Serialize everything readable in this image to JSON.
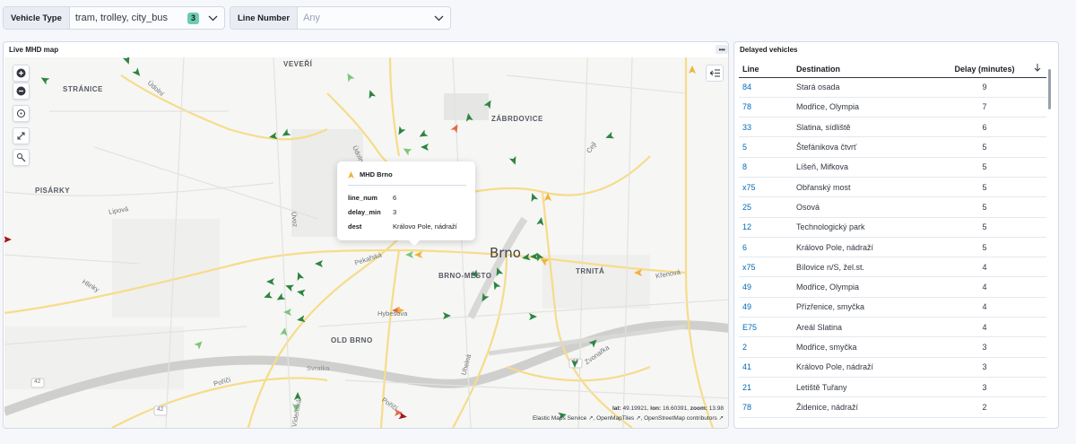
{
  "filters": {
    "vehicle_type": {
      "label": "Vehicle Type",
      "value": "tram, trolley, city_bus",
      "count": "3"
    },
    "line_number": {
      "label": "Line Number",
      "placeholder": "Any"
    }
  },
  "map_panel": {
    "title": "Live MHD map",
    "districts": [
      "VEVEŘÍ",
      "STRÁNICE",
      "ZÁBRDOVICE",
      "PISÁRKY",
      "BRNO-MĚSTO",
      "TRNITÁ",
      "OLD BRNO"
    ],
    "city": "Brno",
    "streets": [
      "Údolní",
      "Údolní",
      "Cejl",
      "Lipová",
      "Úvoz",
      "Pekařská",
      "Hlinky",
      "Hybešova",
      "Křenová",
      "Uhelná",
      "Svratka",
      "Poříčí",
      "Zvonařka",
      "Poříčí",
      "Vídeňská"
    ],
    "road_numbers": [
      "42",
      "42",
      "42"
    ],
    "tooltip": {
      "layer": "MHD Brno",
      "rows": [
        {
          "key": "line_num",
          "value": "6"
        },
        {
          "key": "delay_min",
          "value": "3"
        },
        {
          "key": "dest",
          "value": "Královo Pole, nádraží"
        }
      ]
    },
    "coords": {
      "lat_label": "lat:",
      "lat": "49.19921",
      "lon_label": "lon:",
      "lon": "16.60391",
      "zoom_label": "zoom:",
      "zoom": "13.98"
    },
    "attribution": [
      "Elastic Maps Service",
      "OpenMapTiles",
      "OpenStreetMap contributors"
    ],
    "controls": [
      "zoom-in-icon",
      "zoom-out-icon",
      "reset-view-icon",
      "fit-bounds-icon",
      "layers-icon"
    ],
    "colors": {
      "ontime": "#2e8540",
      "slight": "#7bc67b",
      "medium": "#f0b33a",
      "late": "#e8684a",
      "very_late": "#9e1a1a"
    }
  },
  "delayed_panel": {
    "title": "Delayed vehicles",
    "columns": [
      "Line",
      "Destination",
      "Delay (minutes)"
    ],
    "rows": [
      {
        "line": "84",
        "dest": "Stará osada",
        "delay": "9"
      },
      {
        "line": "78",
        "dest": "Modřice, Olympia",
        "delay": "7"
      },
      {
        "line": "33",
        "dest": "Slatina, sídliště",
        "delay": "6"
      },
      {
        "line": "5",
        "dest": "Štefánikova čtvrť",
        "delay": "5"
      },
      {
        "line": "8",
        "dest": "Líšeň, Mifkova",
        "delay": "5"
      },
      {
        "line": "x75",
        "dest": "Obřanský most",
        "delay": "5"
      },
      {
        "line": "25",
        "dest": "Osová",
        "delay": "5"
      },
      {
        "line": "12",
        "dest": "Technologický park",
        "delay": "5"
      },
      {
        "line": "6",
        "dest": "Královo Pole, nádraží",
        "delay": "5"
      },
      {
        "line": "x75",
        "dest": "Bílovice n/S, žel.st.",
        "delay": "4"
      },
      {
        "line": "49",
        "dest": "Modřice, Olympia",
        "delay": "4"
      },
      {
        "line": "49",
        "dest": "Přízřenice, smyčka",
        "delay": "4"
      },
      {
        "line": "E75",
        "dest": "Areál Slatina",
        "delay": "4"
      },
      {
        "line": "2",
        "dest": "Modřice, smyčka",
        "delay": "3"
      },
      {
        "line": "41",
        "dest": "Královo Pole, nádraží",
        "delay": "3"
      },
      {
        "line": "21",
        "dest": "Letiště Tuřany",
        "delay": "3"
      },
      {
        "line": "78",
        "dest": "Židenice, nádraží",
        "delay": "2"
      }
    ]
  }
}
